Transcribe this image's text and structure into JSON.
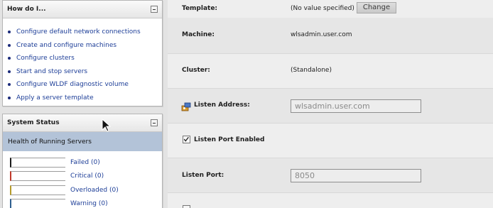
{
  "how_do_i": {
    "title": "How do I...",
    "links": [
      "Configure default network connections",
      "Create and configure machines",
      "Configure clusters",
      "Start and stop servers",
      "Configure WLDF diagnostic volume",
      "Apply a server template"
    ]
  },
  "system_status": {
    "title": "System Status",
    "health_header": "Health of Running Servers",
    "rows": [
      {
        "label": "Failed (0)",
        "color": "#1b1b1b"
      },
      {
        "label": "Critical (0)",
        "color": "#c0392b"
      },
      {
        "label": "Overloaded (0)",
        "color": "#b59b2a"
      },
      {
        "label": "Warning (0)",
        "color": "#2f5f8f"
      }
    ]
  },
  "form": {
    "template_label": "Template:",
    "template_value": "(No value specified)",
    "change_button": "Change",
    "machine_label": "Machine:",
    "machine_value": "wlsadmin.user.com",
    "cluster_label": "Cluster:",
    "cluster_value": "(Standalone)",
    "listen_address_label": "Listen Address:",
    "listen_address_value": "wlsadmin.user.com",
    "listen_port_enabled_label": "Listen Port Enabled",
    "listen_port_enabled_checked": true,
    "listen_port_label": "Listen Port:",
    "listen_port_value": "8050"
  },
  "icons": {
    "collapse": "minus-box-icon",
    "listen_address": "network-address-icon",
    "cursor": "mouse-pointer-icon"
  }
}
